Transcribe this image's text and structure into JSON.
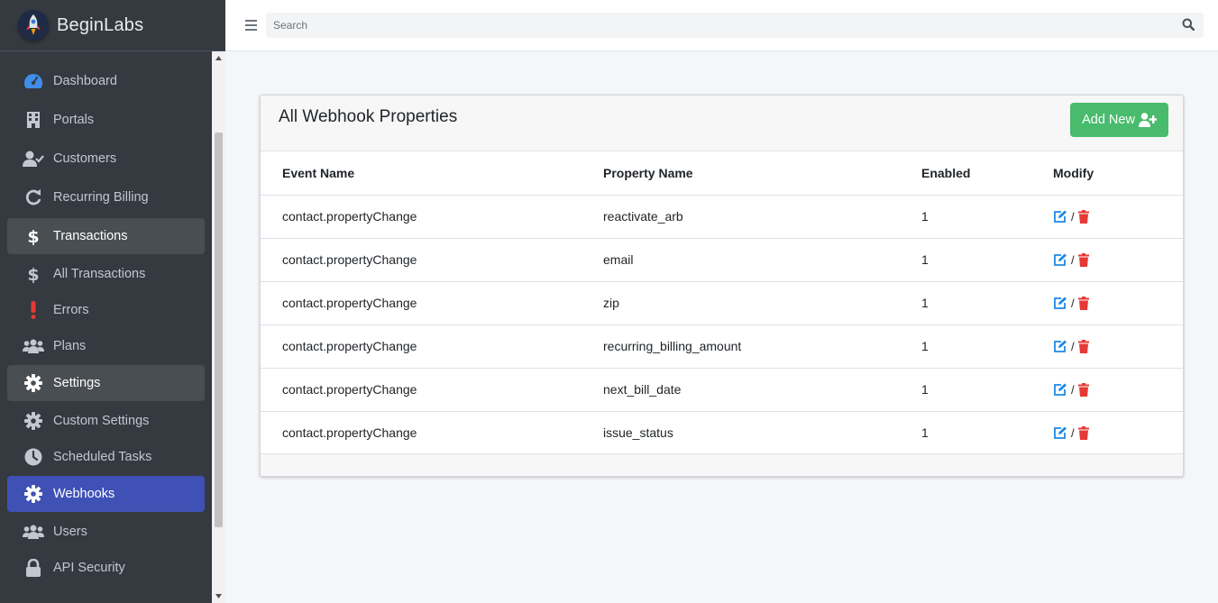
{
  "brand": {
    "name": "BeginLabs"
  },
  "search": {
    "placeholder": "Search"
  },
  "sidebar": {
    "items": [
      {
        "label": "Dashboard",
        "icon": "tachometer-icon"
      },
      {
        "label": "Portals",
        "icon": "building-icon"
      },
      {
        "label": "Customers",
        "icon": "user-check-icon"
      },
      {
        "label": "Recurring Billing",
        "icon": "redo-icon"
      },
      {
        "label": "Transactions",
        "icon": "dollar-icon"
      },
      {
        "label": "All Transactions",
        "icon": "dollar-icon"
      },
      {
        "label": "Errors",
        "icon": "exclamation-icon"
      },
      {
        "label": "Plans",
        "icon": "users-icon"
      },
      {
        "label": "Settings",
        "icon": "gear-icon"
      },
      {
        "label": "Custom Settings",
        "icon": "gear-icon"
      },
      {
        "label": "Scheduled Tasks",
        "icon": "clock-icon"
      },
      {
        "label": "Webhooks",
        "icon": "gear-icon"
      },
      {
        "label": "Users",
        "icon": "users-icon"
      },
      {
        "label": "API Security",
        "icon": "lock-icon"
      }
    ]
  },
  "card": {
    "title": "All Webhook Properties",
    "add_button": "Add New"
  },
  "table": {
    "headers": [
      "Event Name",
      "Property Name",
      "Enabled",
      "Modify"
    ],
    "separator": "/",
    "rows": [
      {
        "event": "contact.propertyChange",
        "property": "reactivate_arb",
        "enabled": "1"
      },
      {
        "event": "contact.propertyChange",
        "property": "email",
        "enabled": "1"
      },
      {
        "event": "contact.propertyChange",
        "property": "zip",
        "enabled": "1"
      },
      {
        "event": "contact.propertyChange",
        "property": "recurring_billing_amount",
        "enabled": "1"
      },
      {
        "event": "contact.propertyChange",
        "property": "next_bill_date",
        "enabled": "1"
      },
      {
        "event": "contact.propertyChange",
        "property": "issue_status",
        "enabled": "1"
      }
    ]
  },
  "colors": {
    "sidebar_bg": "#343a40",
    "active_item": "#3f51b5",
    "add_button": "#48bb6d",
    "edit_icon": "#1e88e5",
    "delete_icon": "#e53935"
  }
}
